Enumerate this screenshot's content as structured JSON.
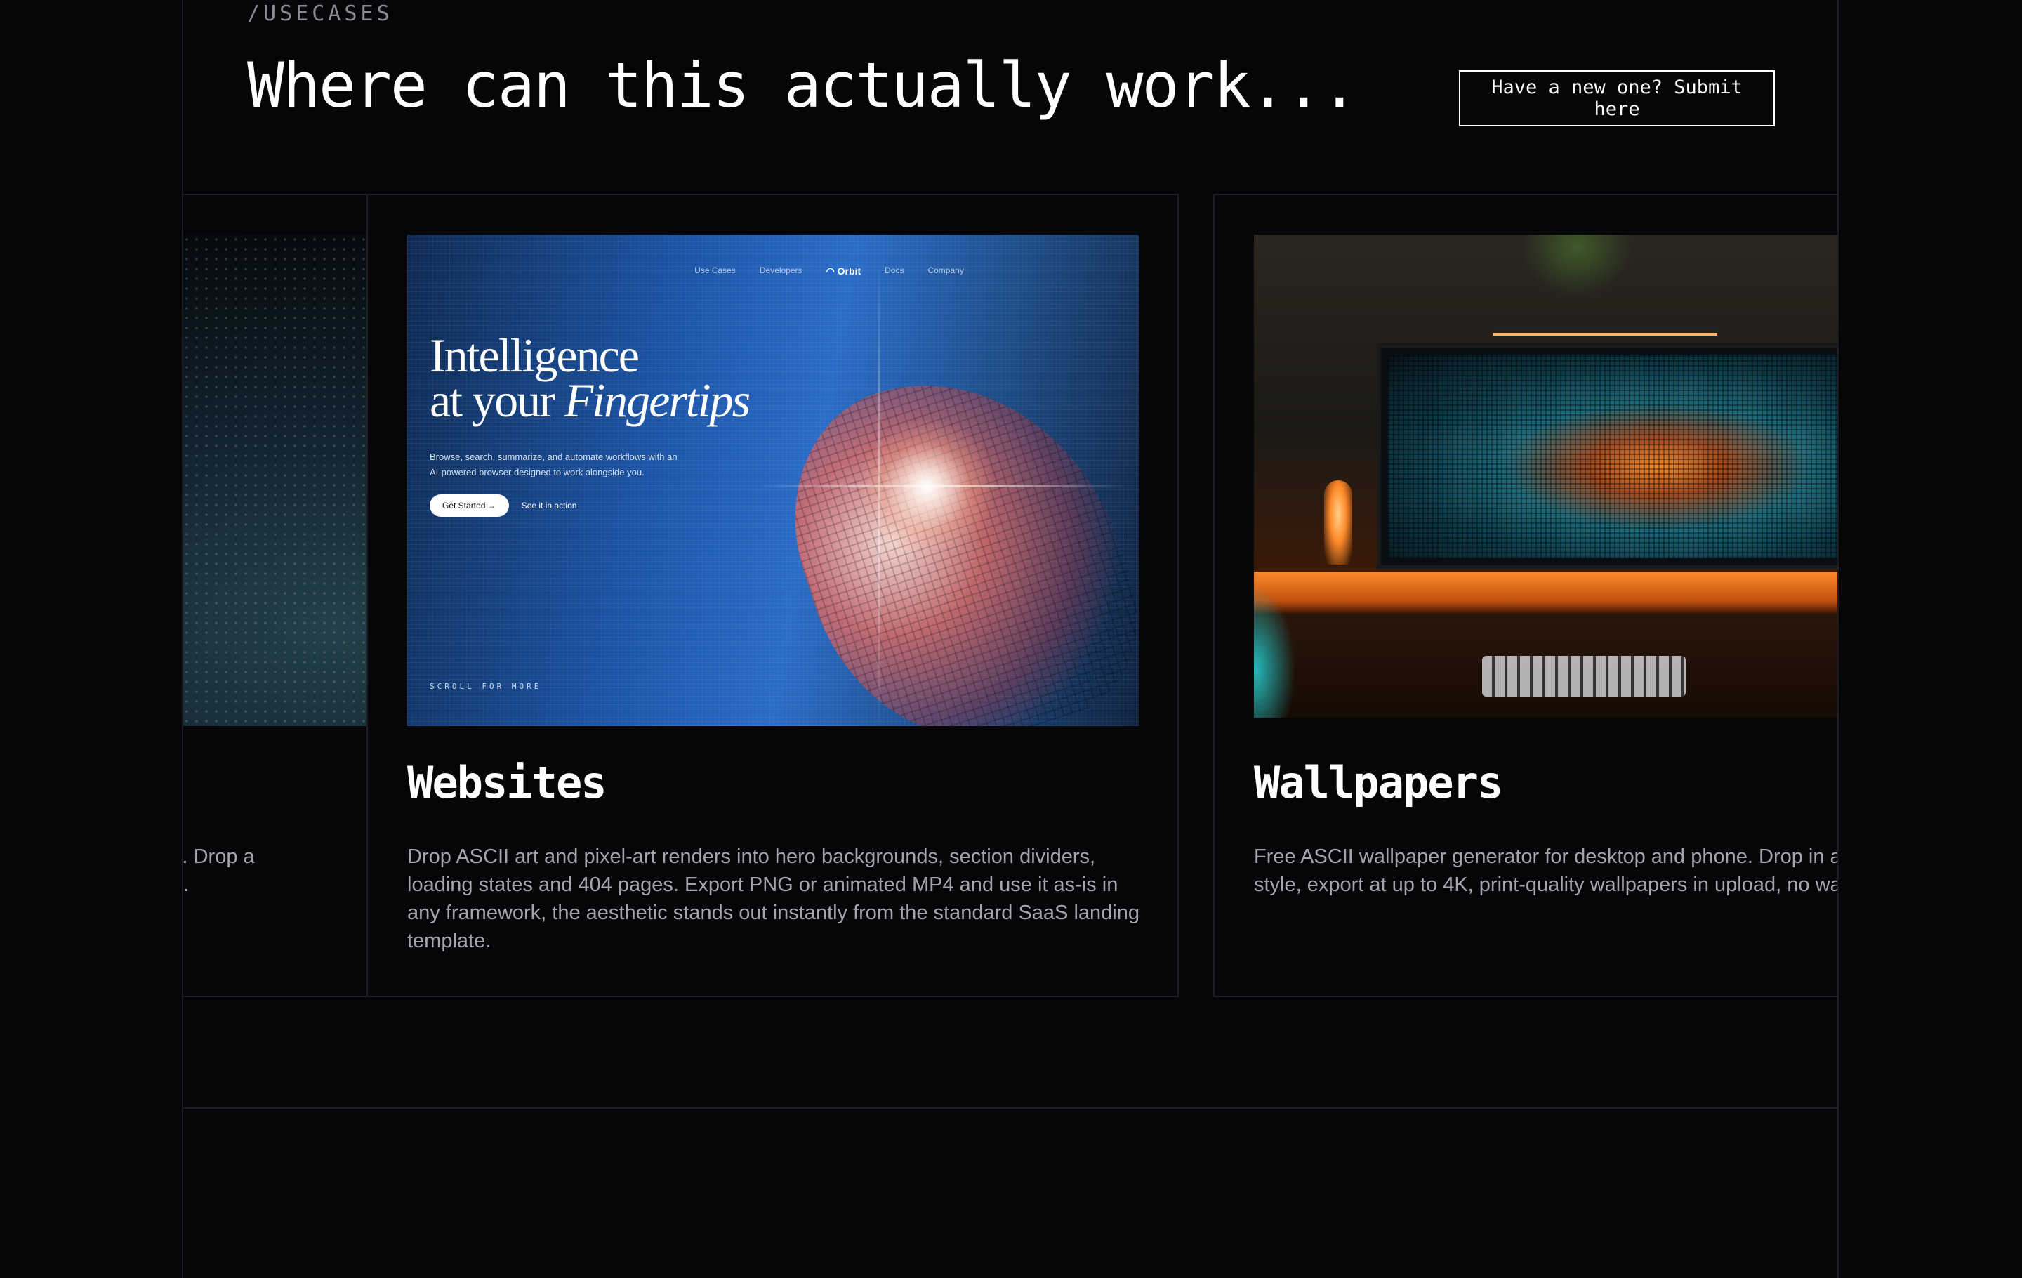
{
  "section": {
    "eyebrow": "/USECASES",
    "headline": "Where can this actually work...",
    "submit_label": "Have a new one? Submit here"
  },
  "cards": [
    {
      "id": "previous",
      "title": "",
      "desc_partial_line1": "s. Drop a",
      "desc_partial_line2": "e."
    },
    {
      "id": "websites",
      "title": "Websites",
      "description": "Drop ASCII art and pixel-art renders into hero backgrounds, section dividers, loading states and 404 pages. Export PNG or animated MP4 and use it as-is in any framework, the aesthetic stands out instantly from the standard SaaS landing template.",
      "preview": {
        "nav": [
          "Use Cases",
          "Developers",
          "Orbit",
          "Docs",
          "Company"
        ],
        "hero_line1": "Intelligence",
        "hero_line2_prefix": "at your ",
        "hero_line2_italic": "Fingertips",
        "subtitle": "Browse, search, summarize, and automate workflows with an AI-powered browser designed to work alongside you.",
        "cta_primary": "Get Started →",
        "cta_secondary": "See it in action",
        "scroll_hint": "SCROLL FOR MORE"
      }
    },
    {
      "id": "wallpapers",
      "title": "Wallpapers",
      "description": "Free ASCII wallpaper generator for desktop and phone. Drop in a photo, pick a style, export at up to 4K, print-quality wallpapers in upload, no watermark."
    }
  ]
}
